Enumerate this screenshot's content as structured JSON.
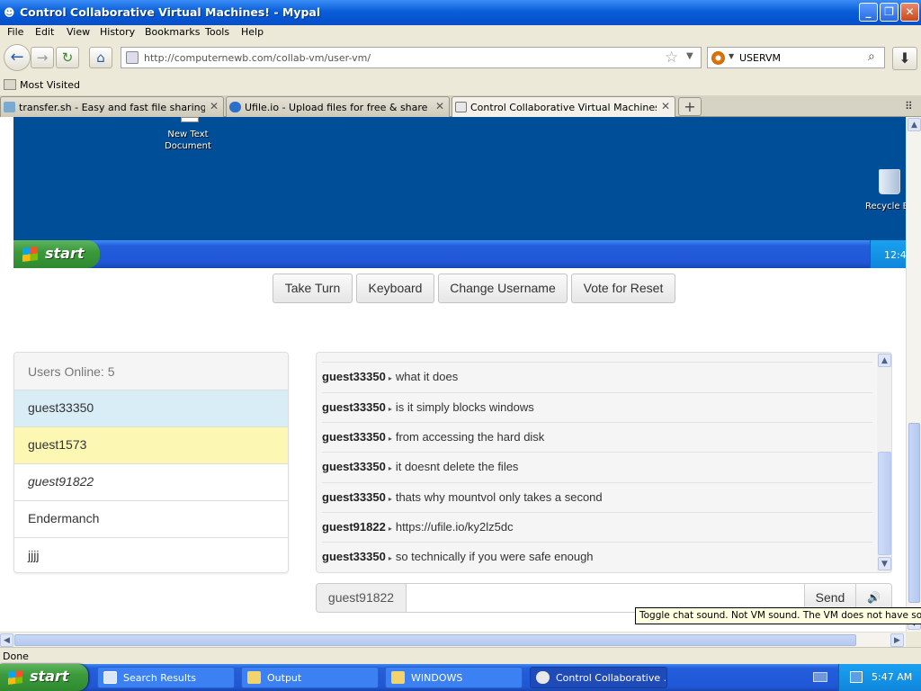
{
  "window": {
    "title": "Control Collaborative Virtual Machines! - Mypal"
  },
  "menu": [
    "File",
    "Edit",
    "View",
    "History",
    "Bookmarks",
    "Tools",
    "Help"
  ],
  "navbar": {
    "url": "http://computernewb.com/collab-vm/user-vm/",
    "search_value": "USERVM"
  },
  "bookmarks": {
    "most_visited": "Most Visited"
  },
  "tabs": [
    {
      "label": "transfer.sh - Easy and fast file sharing fr...",
      "active": false
    },
    {
      "label": "Ufile.io - Upload files for free & share the...",
      "active": false
    },
    {
      "label": "Control Collaborative Virtual Machines!",
      "active": true
    }
  ],
  "vm": {
    "desktop_icon_1": "New Text Document",
    "desktop_icon_2": "Recycle B",
    "start_label": "start",
    "clock": "12:4"
  },
  "controls": {
    "take_turn": "Take Turn",
    "keyboard": "Keyboard",
    "change_username": "Change Username",
    "vote_reset": "Vote for Reset"
  },
  "users": {
    "header": "Users Online: 5",
    "list": [
      {
        "name": "guest33350",
        "state": "self"
      },
      {
        "name": "guest1573",
        "state": "turn"
      },
      {
        "name": "guest91822",
        "state": "italic"
      },
      {
        "name": "Endermanch",
        "state": "normal"
      },
      {
        "name": "jjjj",
        "state": "normal"
      }
    ]
  },
  "chat": {
    "messages": [
      {
        "user": "guest33350",
        "text": "what it does"
      },
      {
        "user": "guest33350",
        "text": "is it simply blocks windows"
      },
      {
        "user": "guest33350",
        "text": "from accessing the hard disk"
      },
      {
        "user": "guest33350",
        "text": "it doesnt delete the files"
      },
      {
        "user": "guest33350",
        "text": "thats why mountvol only takes a second"
      },
      {
        "user": "guest91822",
        "text": "https://ufile.io/ky2lz5dc"
      },
      {
        "user": "guest33350",
        "text": "so technically if you were safe enough"
      }
    ],
    "username": "guest91822",
    "send_label": "Send",
    "input_value": ""
  },
  "tooltip": "Toggle chat sound. Not VM sound. The VM does not have sound.",
  "status": "Done",
  "taskbar": {
    "start_label": "start",
    "items": [
      "Search Results",
      "Output",
      "WINDOWS",
      "Control Collaborative ..."
    ],
    "clock": "5:47 AM"
  }
}
